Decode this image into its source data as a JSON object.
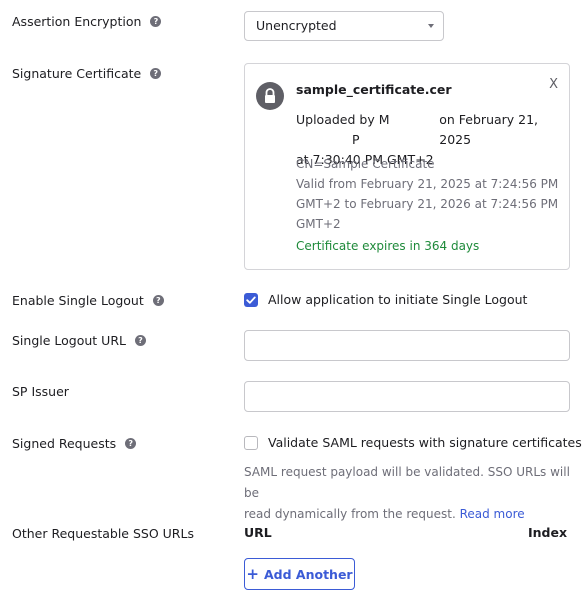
{
  "assertion_encryption": {
    "label": "Assertion Encryption",
    "value": "Unencrypted"
  },
  "signature_certificate": {
    "label": "Signature Certificate",
    "file_name": "sample_certificate.cer",
    "close_label": "X",
    "uploaded_by_prefix": "Uploaded by M",
    "uploaded_by_mid": "P",
    "uploaded_date": "on February 21, 2025",
    "uploaded_time": "at 7:30:40 PM GMT+2",
    "cn": "CN=Sample Certificate",
    "valid_line1": "Valid from February 21, 2025 at 7:24:56 PM",
    "valid_line2": "GMT+2 to February 21, 2026 at 7:24:56 PM",
    "valid_line3": "GMT+2",
    "expires": "Certificate expires in 364 days"
  },
  "single_logout": {
    "label": "Enable Single Logout",
    "checkbox_label": "Allow application to initiate Single Logout",
    "checked": true
  },
  "single_logout_url": {
    "label": "Single Logout URL",
    "value": ""
  },
  "sp_issuer": {
    "label": "SP Issuer",
    "value": ""
  },
  "signed_requests": {
    "label": "Signed Requests",
    "checkbox_label": "Validate SAML requests with signature certificates.",
    "checked": false,
    "hint_line1": "SAML request payload will be validated. SSO URLs will be",
    "hint_line2": "read dynamically from the request.",
    "read_more": "Read more"
  },
  "other_sso_urls": {
    "label": "Other Requestable SSO URLs",
    "col_url": "URL",
    "col_index": "Index",
    "add_button": "Add Another"
  },
  "colors": {
    "accent": "#3b5bd6",
    "success": "#1e8a3a",
    "muted": "#6e6e78"
  }
}
